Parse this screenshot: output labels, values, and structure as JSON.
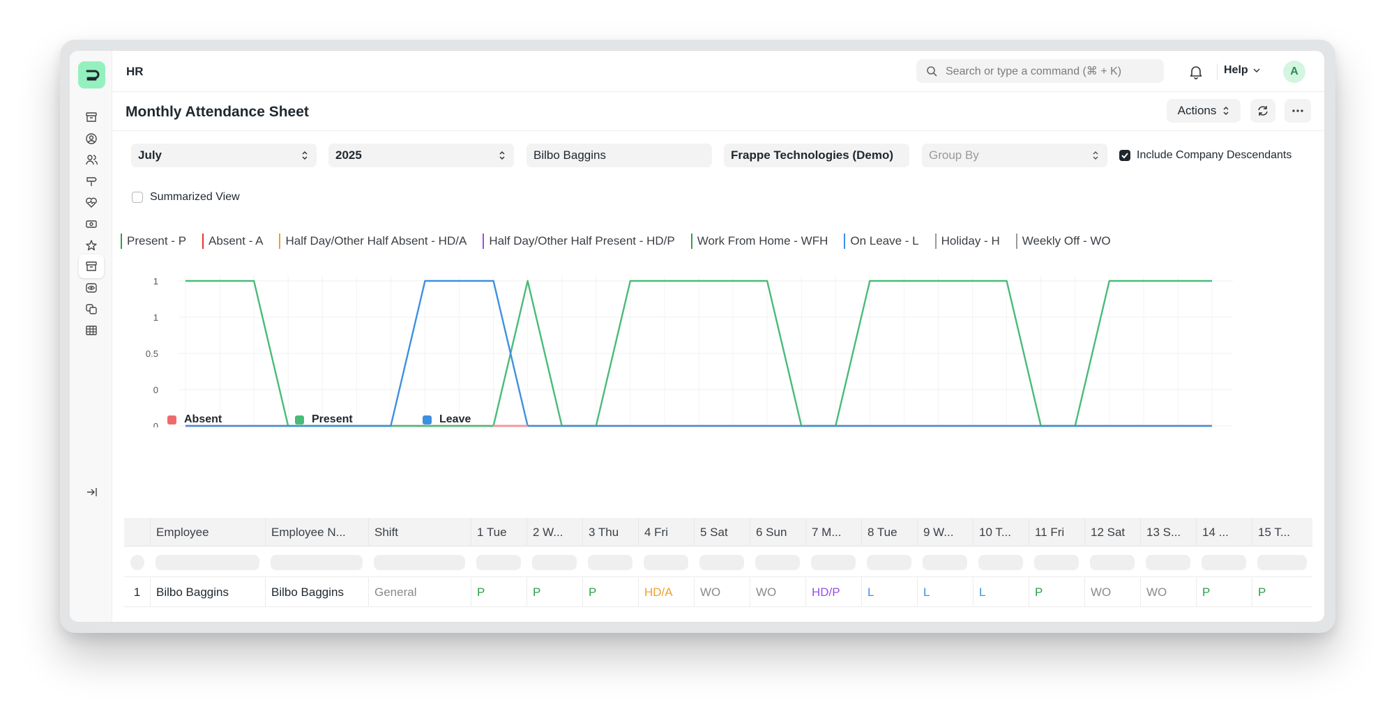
{
  "app": {
    "breadcrumb": "HR",
    "search_placeholder": "Search or type a command (⌘ + K)",
    "help_label": "Help",
    "avatar_initial": "A",
    "brand_color": "#95f0c0"
  },
  "sidebar": {
    "icons": [
      "archive-icon",
      "user-circle-icon",
      "users-icon",
      "signpost-icon",
      "heart-pulse-icon",
      "banknote-icon",
      "star-icon",
      "archive-icon",
      "eye-icon",
      "coins-icon",
      "table-icon",
      "collapse-sidebar-icon"
    ],
    "active_index": 7
  },
  "page": {
    "title": "Monthly Attendance Sheet",
    "actions_label": "Actions"
  },
  "filters": {
    "month": "July",
    "year": "2025",
    "employee": "Bilbo Baggins",
    "company": "Frappe Technologies (Demo)",
    "group_by_placeholder": "Group By",
    "include_company_descendants": "Include Company Descendants",
    "include_company_descendants_checked": true,
    "summarized_view": "Summarized View",
    "summarized_view_checked": false
  },
  "indicators": [
    {
      "label": "Present - P",
      "color": "#2e9e4a"
    },
    {
      "label": "Absent - A",
      "color": "#e03636"
    },
    {
      "label": "Half Day/Other Half Absent - HD/A",
      "color": "#f0a02f"
    },
    {
      "label": "Half Day/Other Half Present - HD/P",
      "color": "#9b4dea"
    },
    {
      "label": "Work From Home - WFH",
      "color": "#2e9e4a"
    },
    {
      "label": "On Leave - L",
      "color": "#3d8fe0"
    },
    {
      "label": "Holiday - H",
      "color": "#9a9a9a"
    },
    {
      "label": "Weekly Off - WO",
      "color": "#9a9a9a"
    }
  ],
  "chart_data": {
    "type": "line",
    "x": [
      "...",
      "...",
      "...",
      "...",
      "...",
      "...",
      "...",
      "...",
      "...",
      "...",
      "...",
      "...",
      "...",
      "...",
      "...",
      "...",
      "...",
      "...",
      "...",
      "...",
      "...",
      "...",
      "...",
      "...",
      "...",
      "...",
      "...",
      "...",
      "...",
      "...",
      "..."
    ],
    "y_tick_labels": [
      "1",
      "1",
      "0.5",
      "0",
      "0"
    ],
    "ylim": [
      0,
      1
    ],
    "grid": true,
    "legend_position": "bottom-left",
    "series": [
      {
        "name": "Absent",
        "color": "#ef6b6b",
        "values": [
          0,
          0,
          0,
          0,
          0,
          0,
          0,
          0,
          0,
          0,
          0,
          0,
          0,
          0,
          0,
          0,
          0,
          0,
          0,
          0,
          0,
          0,
          0,
          0,
          0,
          0,
          0,
          0,
          0,
          0,
          0
        ]
      },
      {
        "name": "Present",
        "color": "#48bb78",
        "values": [
          1,
          1,
          1,
          0,
          0,
          0,
          0,
          0,
          0,
          0,
          1,
          0,
          0,
          1,
          1,
          1,
          1,
          1,
          0,
          0,
          1,
          1,
          1,
          1,
          1,
          0,
          0,
          1,
          1,
          1,
          1
        ]
      },
      {
        "name": "Leave",
        "color": "#3d8fe0",
        "values": [
          0,
          0,
          0,
          0,
          0,
          0,
          0,
          1,
          1,
          1,
          0,
          0,
          0,
          0,
          0,
          0,
          0,
          0,
          0,
          0,
          0,
          0,
          0,
          0,
          0,
          0,
          0,
          0,
          0,
          0,
          0
        ]
      }
    ]
  },
  "table": {
    "columns": [
      "",
      "Employee",
      "Employee N...",
      "Shift",
      "1 Tue",
      "2 W...",
      "3 Thu",
      "4 Fri",
      "5 Sat",
      "6 Sun",
      "7 M...",
      "8 Tue",
      "9 W...",
      "10 T...",
      "11 Fri",
      "12 Sat",
      "13 S...",
      "14 ...",
      "15 T..."
    ],
    "rows": [
      {
        "index": "1",
        "employee": "Bilbo Baggins",
        "employee_name": "Bilbo Baggins",
        "shift": "General",
        "days": [
          {
            "value": "P",
            "color": "#2e9e4a"
          },
          {
            "value": "P",
            "color": "#2e9e4a"
          },
          {
            "value": "P",
            "color": "#2e9e4a"
          },
          {
            "value": "HD/A",
            "color": "#f0a02f"
          },
          {
            "value": "WO",
            "color": "#8a8a8a"
          },
          {
            "value": "WO",
            "color": "#8a8a8a"
          },
          {
            "value": "HD/P",
            "color": "#9b4dea"
          },
          {
            "value": "L",
            "color": "#3d8fe0"
          },
          {
            "value": "L",
            "color": "#3d8fe0"
          },
          {
            "value": "L",
            "color": "#3d8fe0"
          },
          {
            "value": "P",
            "color": "#2e9e4a"
          },
          {
            "value": "WO",
            "color": "#8a8a8a"
          },
          {
            "value": "WO",
            "color": "#8a8a8a"
          },
          {
            "value": "P",
            "color": "#2e9e4a"
          },
          {
            "value": "P",
            "color": "#2e9e4a"
          }
        ]
      }
    ]
  }
}
